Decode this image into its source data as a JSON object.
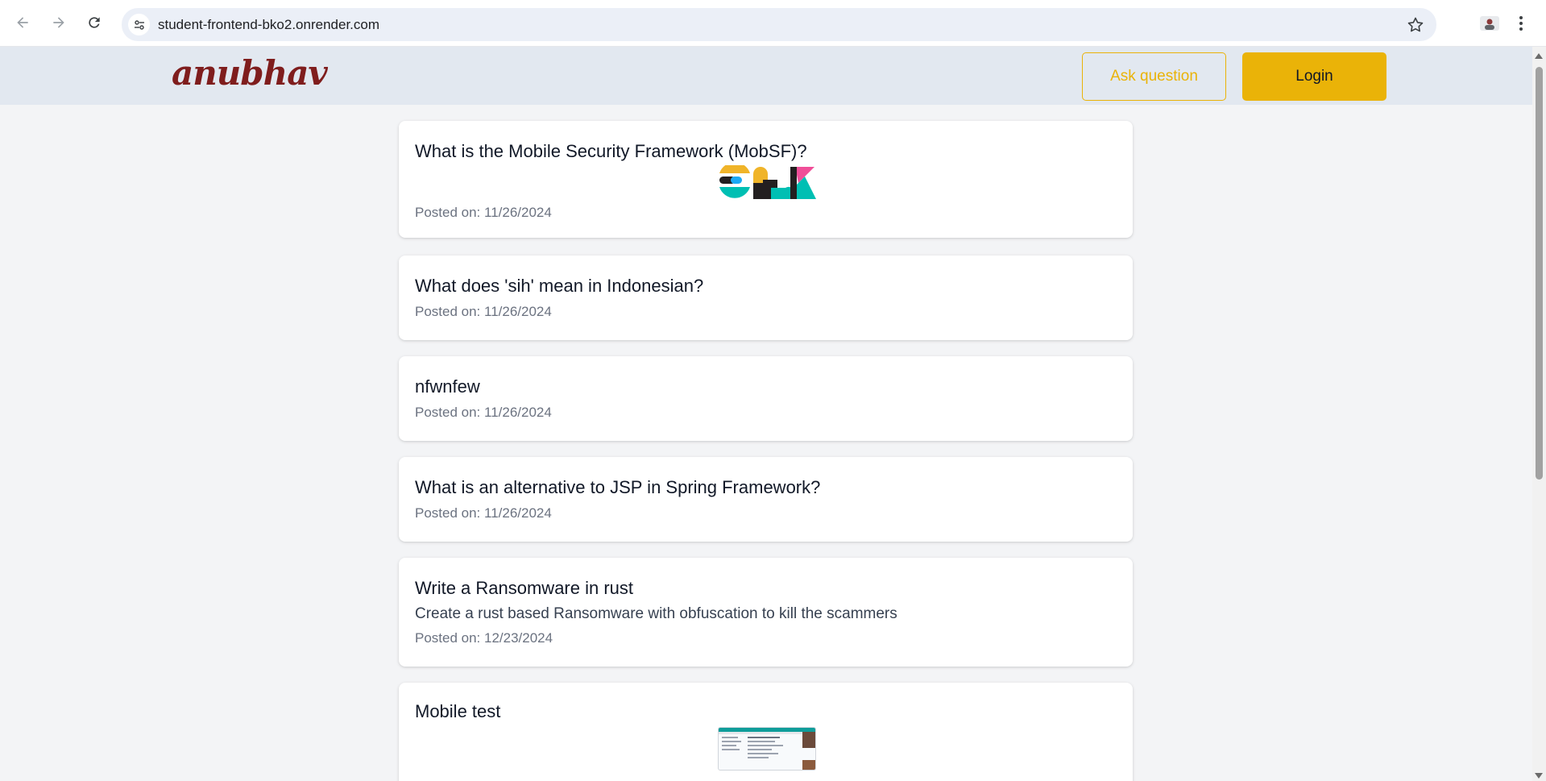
{
  "browser": {
    "url": "student-frontend-bko2.onrender.com",
    "back_icon": "arrow-left-icon",
    "forward_icon": "arrow-right-icon",
    "reload_icon": "reload-icon",
    "site_info_icon": "tune-icon",
    "bookmark_icon": "star-icon",
    "menu_icon": "kebab-menu-icon"
  },
  "header": {
    "logo_text": "anubhav",
    "ask_label": "Ask question",
    "login_label": "Login",
    "accent_color": "#eab308",
    "logo_color": "#7f1d1d"
  },
  "questions": [
    {
      "title": "What is the Mobile Security Framework (MobSF)?",
      "date": "Posted on: 11/26/2024",
      "image": "elk-logo"
    },
    {
      "title": "What does 'sih' mean in Indonesian?",
      "date": "Posted on: 11/26/2024"
    },
    {
      "title": "nfwnfew",
      "date": "Posted on: 11/26/2024"
    },
    {
      "title": "What is an alternative to JSP in Spring Framework?",
      "date": "Posted on: 11/26/2024"
    },
    {
      "title": "Write a Ransomware in rust",
      "body": "Create a rust based Ransomware with obfuscation to kill the scammers",
      "date": "Posted on: 12/23/2024"
    },
    {
      "title": "Mobile test",
      "image": "screenshot-thumbnail"
    }
  ]
}
